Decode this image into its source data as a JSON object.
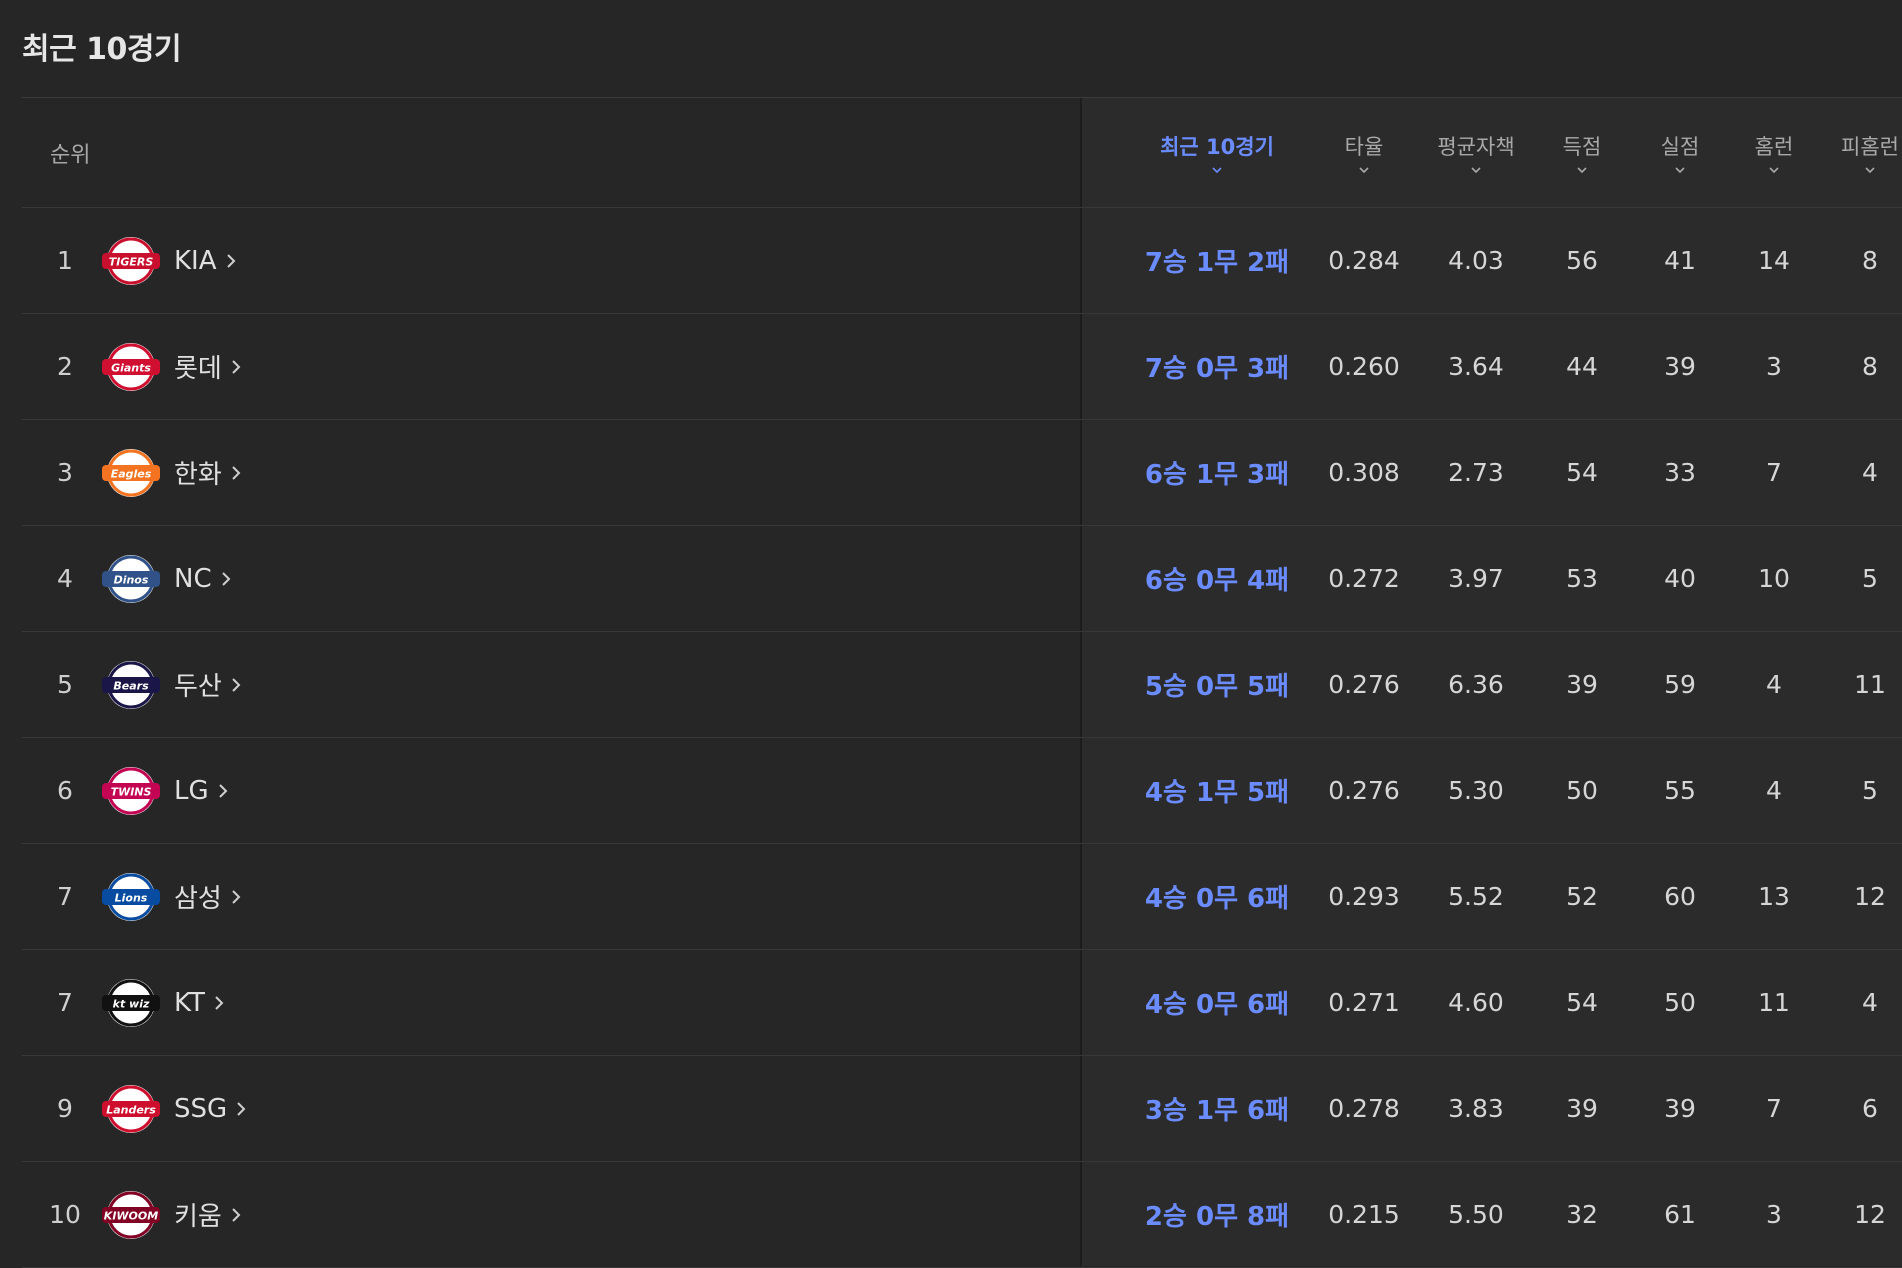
{
  "page": {
    "title": "최근 10경기"
  },
  "table": {
    "headers": {
      "rank": "순위",
      "record": "최근 10경기",
      "avg": "타율",
      "era": "평균자책",
      "runs": "득점",
      "allowed": "실점",
      "hr": "홈런",
      "hr_allowed": "피홈런"
    },
    "rows": [
      {
        "rank": "1",
        "team": "KIA",
        "logo_text": "TIGERS",
        "logo_color": "#c8102e",
        "record": "7승 1무 2패",
        "avg": "0.284",
        "era": "4.03",
        "runs": "56",
        "allowed": "41",
        "hr": "14",
        "hr_allowed": "8"
      },
      {
        "rank": "2",
        "team": "롯데",
        "logo_text": "Giants",
        "logo_color": "#d00f31",
        "record": "7승 0무 3패",
        "avg": "0.260",
        "era": "3.64",
        "runs": "44",
        "allowed": "39",
        "hr": "3",
        "hr_allowed": "8"
      },
      {
        "rank": "3",
        "team": "한화",
        "logo_text": "Eagles",
        "logo_color": "#f37321",
        "record": "6승 1무 3패",
        "avg": "0.308",
        "era": "2.73",
        "runs": "54",
        "allowed": "33",
        "hr": "7",
        "hr_allowed": "4"
      },
      {
        "rank": "4",
        "team": "NC",
        "logo_text": "Dinos",
        "logo_color": "#315288",
        "record": "6승 0무 4패",
        "avg": "0.272",
        "era": "3.97",
        "runs": "53",
        "allowed": "40",
        "hr": "10",
        "hr_allowed": "5"
      },
      {
        "rank": "5",
        "team": "두산",
        "logo_text": "Bears",
        "logo_color": "#1a1748",
        "record": "5승 0무 5패",
        "avg": "0.276",
        "era": "6.36",
        "runs": "39",
        "allowed": "59",
        "hr": "4",
        "hr_allowed": "11"
      },
      {
        "rank": "6",
        "team": "LG",
        "logo_text": "TWINS",
        "logo_color": "#c30452",
        "record": "4승 1무 5패",
        "avg": "0.276",
        "era": "5.30",
        "runs": "50",
        "allowed": "55",
        "hr": "4",
        "hr_allowed": "5"
      },
      {
        "rank": "7",
        "team": "삼성",
        "logo_text": "Lions",
        "logo_color": "#074ca1",
        "record": "4승 0무 6패",
        "avg": "0.293",
        "era": "5.52",
        "runs": "52",
        "allowed": "60",
        "hr": "13",
        "hr_allowed": "12"
      },
      {
        "rank": "7",
        "team": "KT",
        "logo_text": "kt wiz",
        "logo_color": "#111111",
        "record": "4승 0무 6패",
        "avg": "0.271",
        "era": "4.60",
        "runs": "54",
        "allowed": "50",
        "hr": "11",
        "hr_allowed": "4"
      },
      {
        "rank": "9",
        "team": "SSG",
        "logo_text": "Landers",
        "logo_color": "#ce0e2d",
        "record": "3승 1무 6패",
        "avg": "0.278",
        "era": "3.83",
        "runs": "39",
        "allowed": "39",
        "hr": "7",
        "hr_allowed": "6"
      },
      {
        "rank": "10",
        "team": "키움",
        "logo_text": "KIWOOM",
        "logo_color": "#820024",
        "record": "2승 0무 8패",
        "avg": "0.215",
        "era": "5.50",
        "runs": "32",
        "allowed": "61",
        "hr": "3",
        "hr_allowed": "12"
      }
    ]
  },
  "colors": {
    "background": "#262626",
    "accent": "#6b8cff",
    "text": "#d6d6d6",
    "muted": "#a8a8a8"
  }
}
